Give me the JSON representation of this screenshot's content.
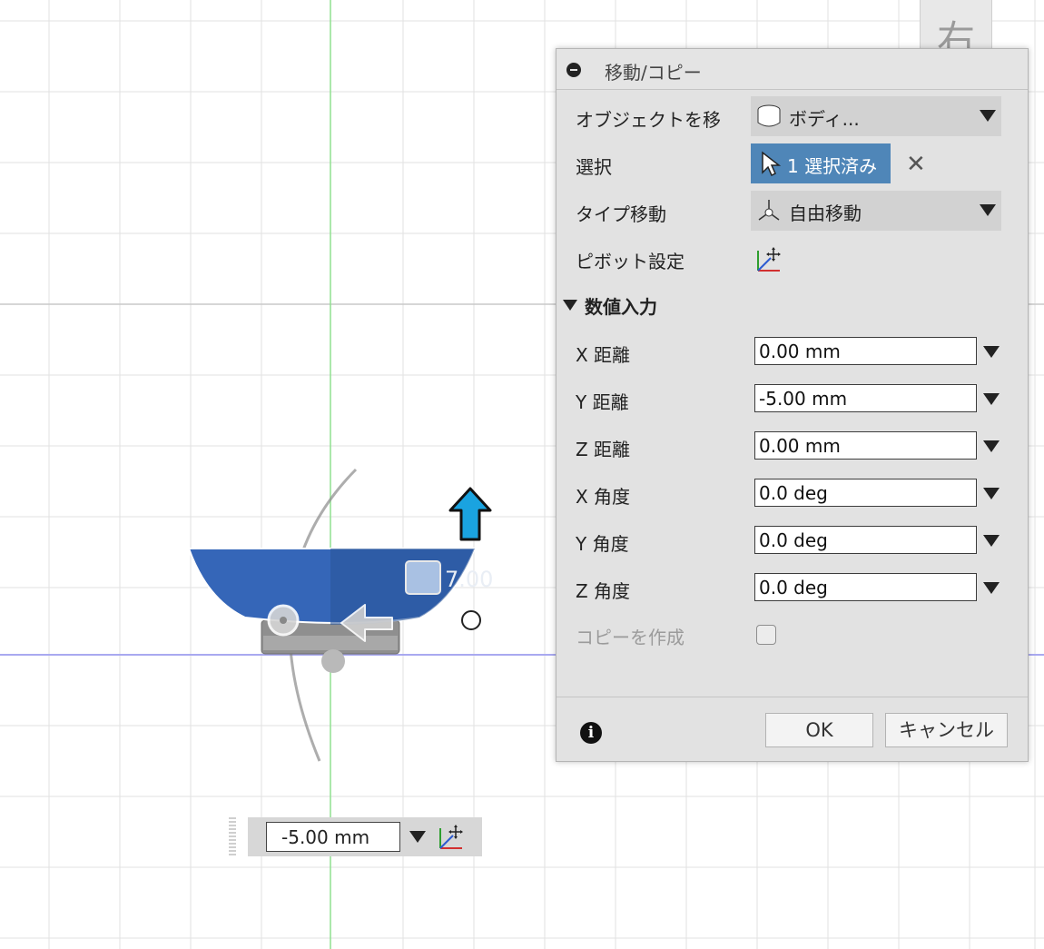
{
  "viewcube": {
    "label": "右"
  },
  "viewport": {
    "ghost_dimension": "7.00"
  },
  "dialog": {
    "title": "移動/コピー",
    "rows": {
      "object_label": "オブジェクトを移",
      "object_value": "ボディ...",
      "selection_label": "選択",
      "selection_value": "1 選択済み",
      "type_label": "タイプ移動",
      "type_value": "自由移動",
      "pivot_label": "ピボット設定"
    },
    "section": {
      "label": "数値入力"
    },
    "fields": [
      {
        "label": "X 距離",
        "value": "0.00 mm"
      },
      {
        "label": "Y 距離",
        "value": "-5.00 mm"
      },
      {
        "label": "Z 距離",
        "value": "0.00 mm"
      },
      {
        "label": "X 角度",
        "value": "0.0 deg"
      },
      {
        "label": "Y 角度",
        "value": "0.0 deg"
      },
      {
        "label": "Z 角度",
        "value": "0.0 deg"
      }
    ],
    "copy_label": "コピーを作成",
    "copy_checked": false,
    "ok_label": "OK",
    "cancel_label": "キャンセル"
  },
  "floating_input": {
    "value": "-5.00 mm"
  },
  "icons": [
    "collapse-icon",
    "cylinder-body-icon",
    "dropdown-caret-icon",
    "cursor-arrow-icon",
    "close-icon",
    "free-move-icon",
    "pivot-axes-icon",
    "info-icon",
    "up-arrow-manipulator-icon",
    "left-arrow-manipulator-icon",
    "plane-handle-icon",
    "rotate-ring-icon"
  ],
  "colors": {
    "body": "#3566b8",
    "selection": "#4f86b8",
    "grid": "#d9d9d9",
    "axis_green": "#8fe08f",
    "axis_blue": "#a9a9f0",
    "manipulator_arrow": "#1aa3e0"
  }
}
